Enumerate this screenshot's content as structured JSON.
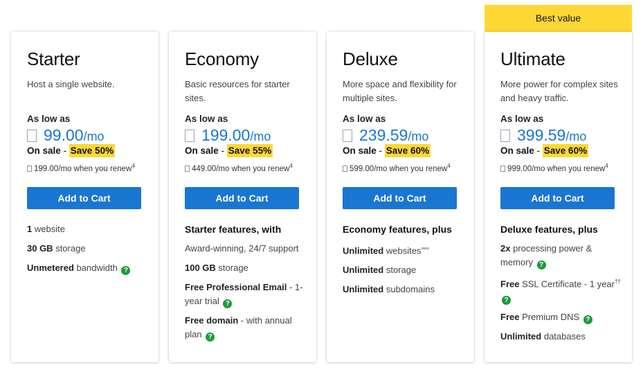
{
  "ribbon": {
    "label": "Best value",
    "color": "#fdd835"
  },
  "accent_color": "#1976d2",
  "plans": [
    {
      "name": "Starter",
      "description": "Host a single website.",
      "price_prefix": "As low as",
      "price": "99.00",
      "price_unit": "/mo",
      "sale_label": "On sale",
      "sale_separator": " - ",
      "save_badge": "Save 50%",
      "renew_price": "199.00",
      "renew_text": "/mo when you renew",
      "renew_note": "4",
      "cta": "Add to Cart",
      "features": [
        {
          "bold": "1",
          "text": " website"
        },
        {
          "bold": "30 GB",
          "text": " storage"
        },
        {
          "bold": "Unmetered",
          "text": " bandwidth",
          "help": true
        }
      ]
    },
    {
      "name": "Economy",
      "description": "Basic resources for starter sites.",
      "price_prefix": "As low as",
      "price": "199.00",
      "price_unit": "/mo",
      "sale_label": "On sale",
      "sale_separator": " - ",
      "save_badge": "Save 55%",
      "renew_price": "449.00",
      "renew_text": "/mo when you renew",
      "renew_note": "4",
      "cta": "Add to Cart",
      "features_heading": "Starter features, with",
      "features": [
        {
          "text": "Award-winning, 24/7 support"
        },
        {
          "bold": "100 GB",
          "text": " storage"
        },
        {
          "bold": "Free Professional Email",
          "text": " - 1-year trial",
          "help": true
        },
        {
          "bold": "Free domain",
          "text": " - with annual plan",
          "help": true
        }
      ]
    },
    {
      "name": "Deluxe",
      "description": "More space and flexibility for multiple sites.",
      "price_prefix": "As low as",
      "price": "239.59",
      "price_unit": "/mo",
      "sale_label": "On sale",
      "sale_separator": " - ",
      "save_badge": "Save 60%",
      "renew_price": "599.00",
      "renew_text": "/mo when you renew",
      "renew_note": "4",
      "cta": "Add to Cart",
      "features_heading": "Economy features, plus",
      "features": [
        {
          "bold": "Unlimited",
          "text": " websites",
          "sup": "∞∞"
        },
        {
          "bold": "Unlimited",
          "text": " storage"
        },
        {
          "bold": "Unlimited",
          "text": " subdomains"
        }
      ]
    },
    {
      "name": "Ultimate",
      "description": "More power for complex sites and heavy traffic.",
      "price_prefix": "As low as",
      "price": "399.59",
      "price_unit": "/mo",
      "sale_label": "On sale",
      "sale_separator": " - ",
      "save_badge": "Save 60%",
      "renew_price": "999.00",
      "renew_text": "/mo when you renew",
      "renew_note": "4",
      "cta": "Add to Cart",
      "features_heading": "Deluxe features, plus",
      "features": [
        {
          "bold": "2x",
          "text": " processing power & memory",
          "help": true
        },
        {
          "bold": "Free",
          "text": " SSL Certificate - 1 year",
          "sup": "††",
          "help": true
        },
        {
          "bold": "Free",
          "text": " Premium DNS",
          "help": true
        },
        {
          "bold": "Unlimited",
          "text": " databases"
        }
      ]
    }
  ]
}
